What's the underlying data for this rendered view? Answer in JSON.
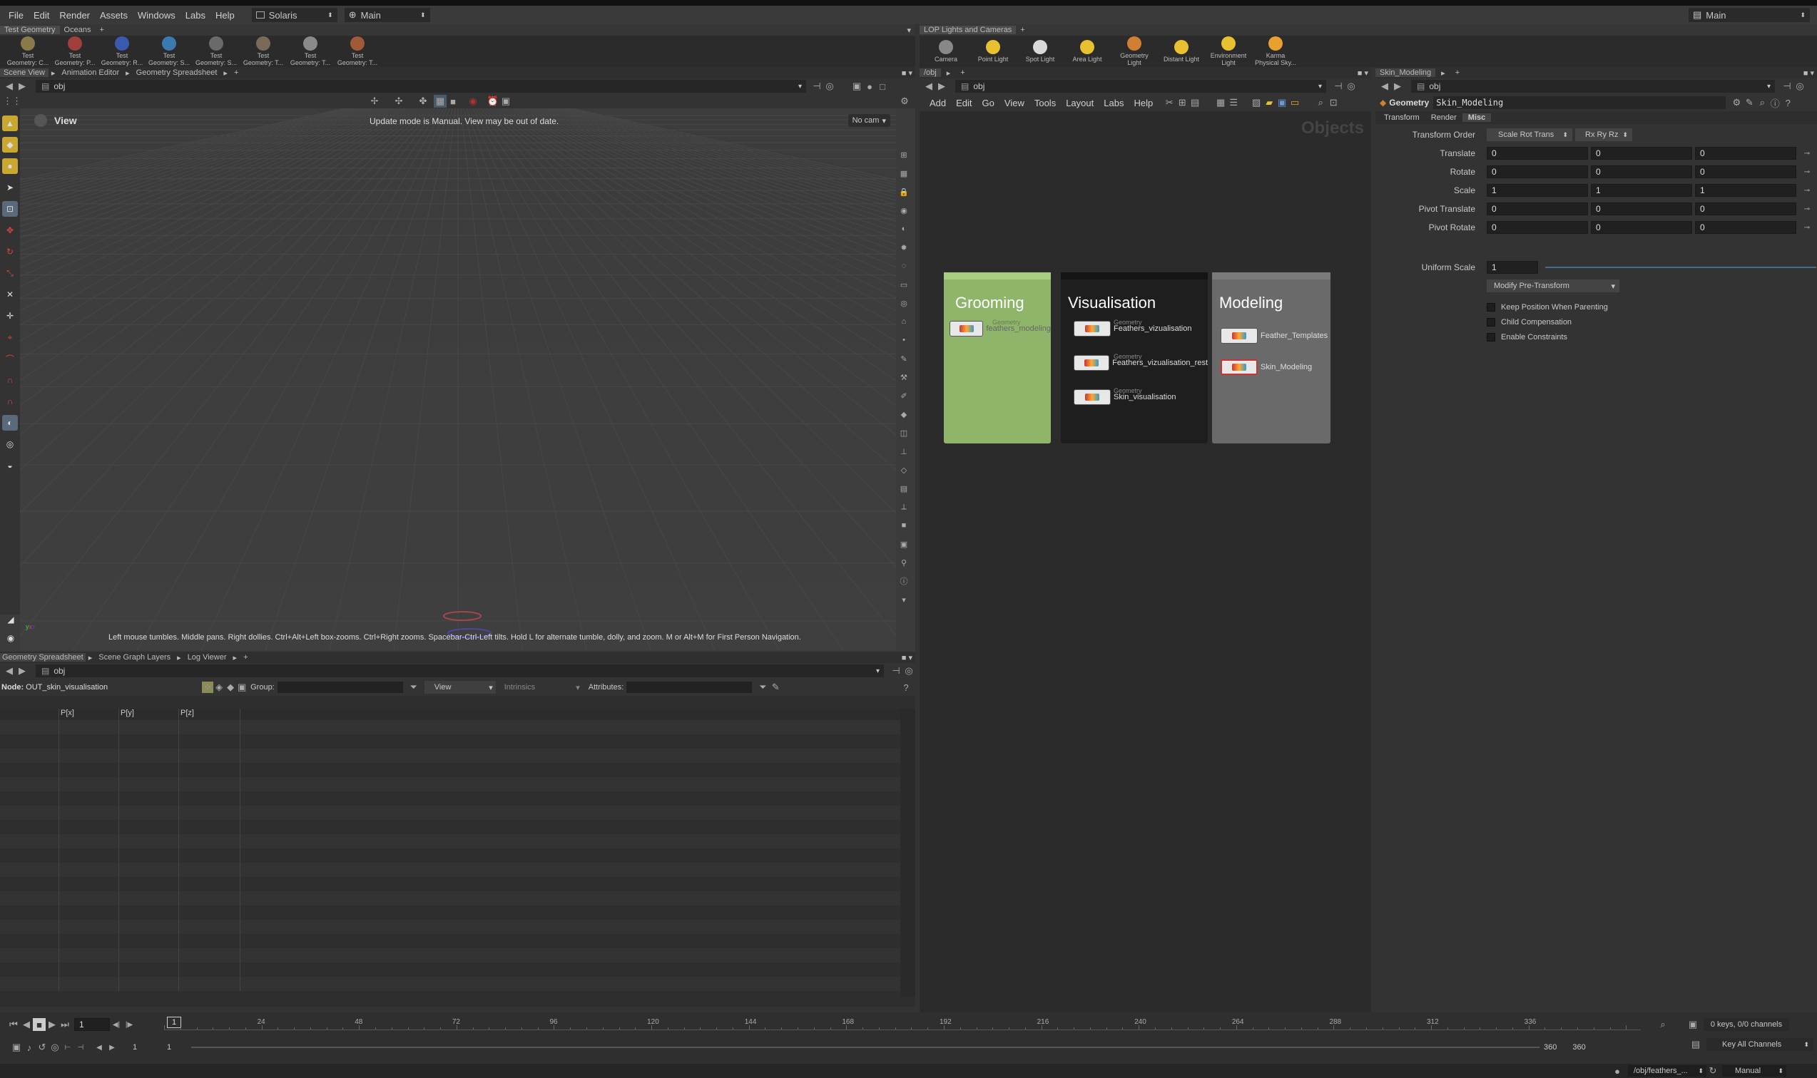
{
  "menu": {
    "items": [
      "File",
      "Edit",
      "Render",
      "Assets",
      "Windows",
      "Labs",
      "Help"
    ],
    "desktop": "Solaris",
    "context": "Main",
    "right_context": "Main"
  },
  "shelf_left": {
    "tabs": [
      "Test Geometry",
      "Oceans"
    ],
    "tools": [
      {
        "l1": "Test",
        "l2": "Geometry: C...",
        "color": "#8a7a4a"
      },
      {
        "l1": "Test",
        "l2": "Geometry: P...",
        "color": "#a0403a"
      },
      {
        "l1": "Test",
        "l2": "Geometry: R...",
        "color": "#3a5ab0"
      },
      {
        "l1": "Test",
        "l2": "Geometry: S...",
        "color": "#3a7ab0"
      },
      {
        "l1": "Test",
        "l2": "Geometry: S...",
        "color": "#6a6a6a"
      },
      {
        "l1": "Test",
        "l2": "Geometry: T...",
        "color": "#7a6a5a"
      },
      {
        "l1": "Test",
        "l2": "Geometry: T...",
        "color": "#8a8a8a"
      },
      {
        "l1": "Test",
        "l2": "Geometry: T...",
        "color": "#a05a3a"
      }
    ]
  },
  "shelf_right": {
    "tabs": [
      "LOP Lights and Cameras"
    ],
    "tools": [
      {
        "l1": "Camera",
        "l2": "",
        "color": "#888"
      },
      {
        "l1": "Point Light",
        "l2": "",
        "color": "#e8c030"
      },
      {
        "l1": "Spot Light",
        "l2": "",
        "color": "#d8d8d8"
      },
      {
        "l1": "Area Light",
        "l2": "",
        "color": "#e8c030"
      },
      {
        "l1": "Geometry",
        "l2": "Light",
        "color": "#d08030"
      },
      {
        "l1": "Distant Light",
        "l2": "",
        "color": "#e8c030"
      },
      {
        "l1": "Environment",
        "l2": "Light",
        "color": "#e8c030"
      },
      {
        "l1": "Karma",
        "l2": "Physical Sky...",
        "color": "#e8a030"
      }
    ]
  },
  "viewer": {
    "tabs": [
      "Scene View",
      "Animation Editor",
      "Geometry Spreadsheet"
    ],
    "path": "obj",
    "view_label": "View",
    "update_msg": "Update mode is Manual. View may be out of date.",
    "cam": "No cam",
    "hint": "Left mouse tumbles. Middle pans. Right dollies. Ctrl+Alt+Left box-zooms. Ctrl+Right zooms. Spacebar-Ctrl-Left tilts. Hold L for alternate tumble, dolly, and zoom. M or Alt+M for First Person Navigation."
  },
  "spreadsheet": {
    "tabs": [
      "Geometry Spreadsheet",
      "Scene Graph Layers",
      "Log Viewer"
    ],
    "path": "obj",
    "node_label": "Node:",
    "node_value": "OUT_skin_visualisation",
    "group_label": "Group:",
    "view_value": "View",
    "intrinsics": "Intrinsics",
    "attributes_label": "Attributes:",
    "columns": [
      "",
      "P[x]",
      "P[y]",
      "P[z]"
    ]
  },
  "network": {
    "tab": "/obj",
    "path": "obj",
    "menu": [
      "Add",
      "Edit",
      "Go",
      "View",
      "Tools",
      "Layout",
      "Labs",
      "Help"
    ],
    "context_label": "Objects",
    "boxes": [
      {
        "title": "Grooming",
        "nodes": [
          {
            "type": "Geometry",
            "name": "feathers_modeling"
          }
        ],
        "color": "#8fb56a"
      },
      {
        "title": "Visualisation",
        "nodes": [
          {
            "type": "Geometry",
            "name": "Feathers_vizualisation"
          },
          {
            "type": "Geometry",
            "name": "Feathers_vizualisation_rest"
          },
          {
            "type": "Geometry",
            "name": "Skin_visualisation"
          }
        ],
        "color": "#1e1e1e"
      },
      {
        "title": "Modeling",
        "nodes": [
          {
            "type": "",
            "name": "Feather_Templates"
          },
          {
            "type": "",
            "name": "Skin_Modeling"
          }
        ],
        "color": "#6a6a6a"
      }
    ]
  },
  "params": {
    "tab": "Skin_Modeling",
    "path": "obj",
    "node_type": "Geometry",
    "node_name": "Skin_Modeling",
    "subtabs": [
      "Transform",
      "Render",
      "Misc"
    ],
    "transform_order_label": "Transform Order",
    "transform_order": "Scale Rot Trans",
    "rot_order": "Rx Ry Rz",
    "rows": [
      {
        "label": "Translate",
        "v": [
          "0",
          "0",
          "0"
        ]
      },
      {
        "label": "Rotate",
        "v": [
          "0",
          "0",
          "0"
        ]
      },
      {
        "label": "Scale",
        "v": [
          "1",
          "1",
          "1"
        ]
      },
      {
        "label": "Pivot Translate",
        "v": [
          "0",
          "0",
          "0"
        ]
      },
      {
        "label": "Pivot Rotate",
        "v": [
          "0",
          "0",
          "0"
        ]
      }
    ],
    "uniform_scale_label": "Uniform Scale",
    "uniform_scale": "1",
    "pretransform": "Modify Pre-Transform",
    "checks": [
      "Keep Position When Parenting",
      "Child Compensation",
      "Enable Constraints"
    ]
  },
  "timeline": {
    "frame": "1",
    "marker": "1",
    "ticks": [
      "24",
      "48",
      "72",
      "96",
      "120",
      "144",
      "168",
      "192",
      "216",
      "240",
      "264",
      "288",
      "312",
      "336"
    ],
    "start": "1",
    "start2": "1",
    "end": "360",
    "end2": "360",
    "keys": "0 keys, 0/0 channels",
    "key_all": "Key All Channels"
  },
  "status": {
    "path": "/obj/feathers_...",
    "mode": "Manual"
  }
}
